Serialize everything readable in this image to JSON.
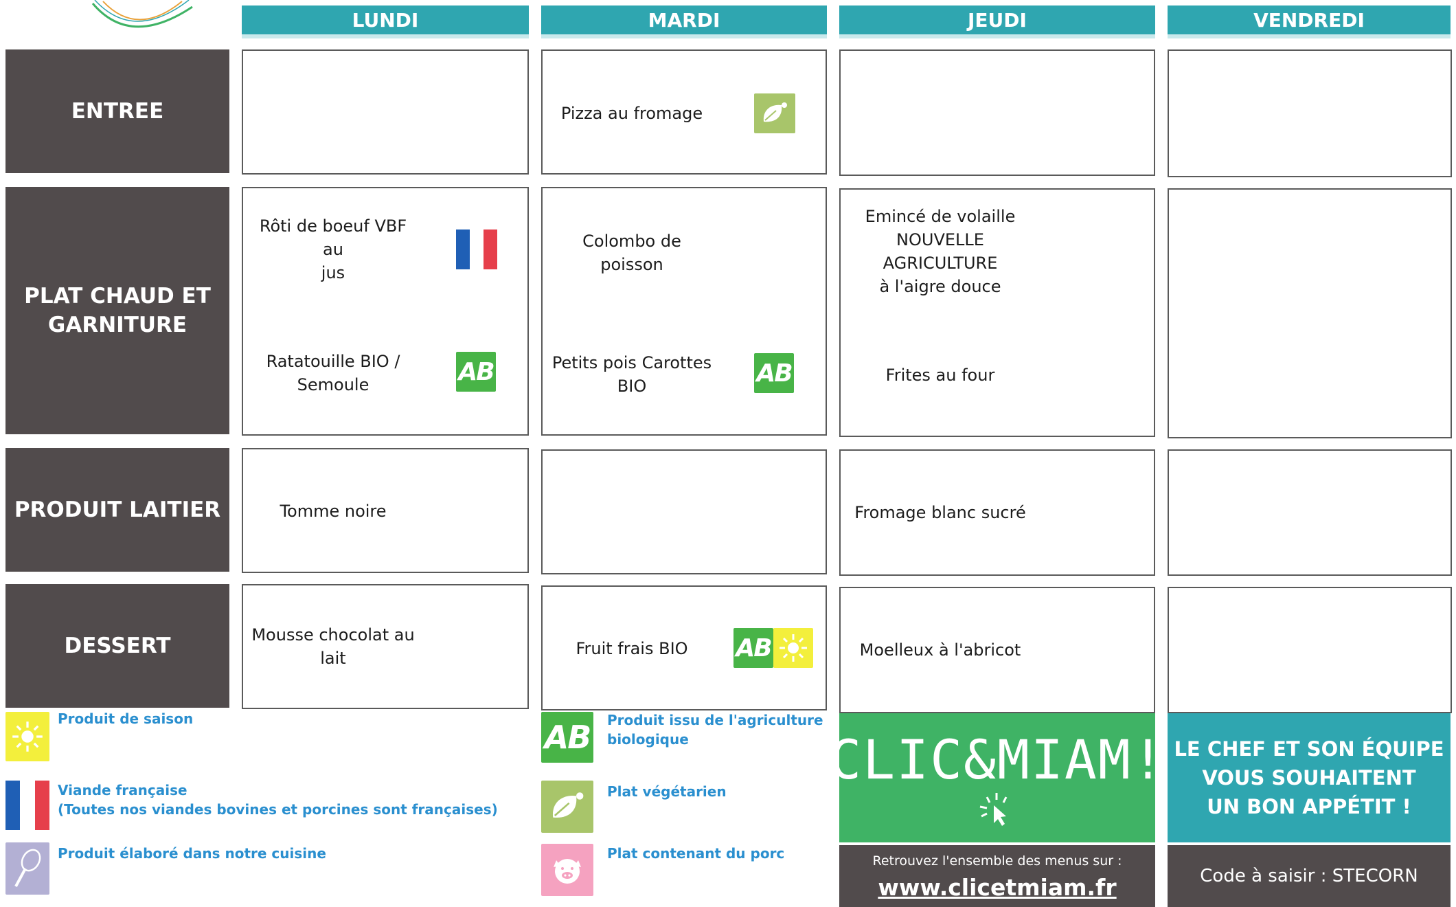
{
  "days": [
    "LUNDI",
    "MARDI",
    "JEUDI",
    "VENDREDI"
  ],
  "rows": {
    "entree": "ENTREE",
    "plat_line1": "PLAT CHAUD ET",
    "plat_line2": "GARNITURE",
    "laitier": "PRODUIT LAITIER",
    "dessert": "DESSERT"
  },
  "dishes": {
    "mardi_entree": "Pizza au fromage",
    "lundi_plat_1a": "Rôti de boeuf VBF au",
    "lundi_plat_1b": "jus",
    "lundi_plat_2a": "Ratatouille BIO /",
    "lundi_plat_2b": "Semoule",
    "mardi_plat_1": "Colombo de poisson",
    "mardi_plat_2a": "Petits pois Carottes",
    "mardi_plat_2b": "BIO",
    "jeudi_plat_1a": "Emincé de volaille",
    "jeudi_plat_1b": "NOUVELLE AGRICULTURE",
    "jeudi_plat_1c": "à l'aigre douce",
    "jeudi_plat_2": "Frites au four",
    "lundi_laitier": "Tomme noire",
    "jeudi_laitier": "Fromage blanc sucré",
    "lundi_dessert_a": "Mousse chocolat au",
    "lundi_dessert_b": "lait",
    "mardi_dessert": "Fruit frais BIO",
    "jeudi_dessert": "Moelleux à l'abricot"
  },
  "badges": {
    "bio_label": "AB"
  },
  "legend": {
    "saison": "Produit de saison",
    "viande_1": "Viande française",
    "viande_2": "(Toutes nos viandes bovines et porcines sont françaises)",
    "cuisine": "Produit élaboré dans notre cuisine",
    "bio_1": "Produit issu de l'agriculture",
    "bio_2": "biologique",
    "vege": "Plat végétarien",
    "porc": "Plat contenant du porc"
  },
  "promo": {
    "logo_text": "CLIC&MIAM!",
    "site_intro": "Retrouvez l'ensemble des menus sur :",
    "site_url": "www.clicetmiam.fr",
    "chef_1": "LE CHEF ET SON ÉQUIPE",
    "chef_2": "VOUS SOUHAITENT",
    "chef_3": "UN BON APPÉTIT !",
    "code": "Code à saisir : STECORN"
  },
  "colors": {
    "teal": "#2fa6b0",
    "dark_gray": "#514b4c",
    "bio_green": "#48b447",
    "veg_green": "#a8c56a",
    "sun_yellow": "#f3ef3c",
    "legend_blue": "#2a8fcf",
    "clic_green": "#3fb365",
    "pig_pink": "#f5a2c0"
  },
  "icons": [
    "sun-icon",
    "french-flag-icon",
    "whisk-icon",
    "bio-ab-icon",
    "leaf-icon",
    "pig-icon",
    "cursor-icon"
  ]
}
